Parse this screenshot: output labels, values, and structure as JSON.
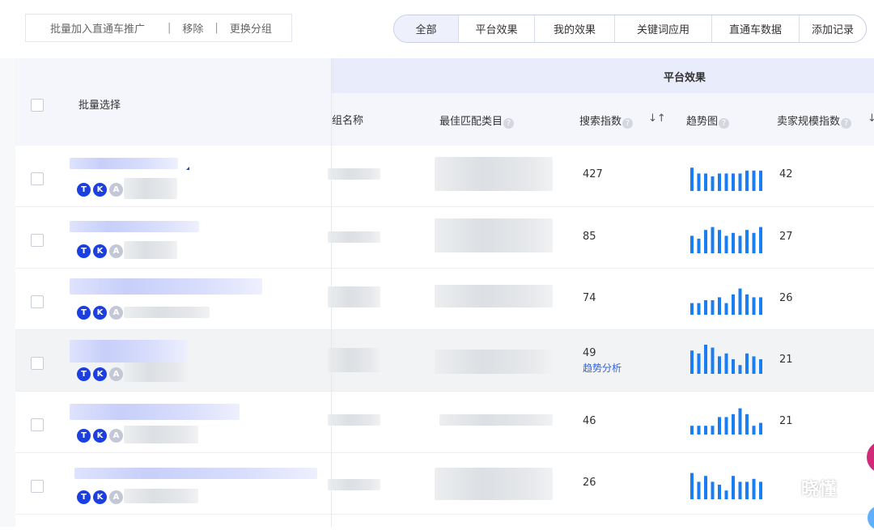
{
  "toolbar": {
    "batch_add_label": "批量加入直通车推广",
    "remove_label": "移除",
    "change_group_label": "更换分组",
    "separator": "|"
  },
  "tabs": [
    {
      "label": "全部",
      "active": true
    },
    {
      "label": "平台效果",
      "active": false
    },
    {
      "label": "我的效果",
      "active": false
    },
    {
      "label": "关键词应用",
      "active": false
    },
    {
      "label": "直通车数据",
      "active": false
    },
    {
      "label": "添加记录",
      "active": false
    }
  ],
  "table": {
    "group_title": "平台效果",
    "headers": {
      "batch_select": "批量选择",
      "group_name": "组名称",
      "best_category": "最佳匹配类目",
      "search_index": "搜索指数",
      "trend": "趋势图",
      "seller_scale": "卖家规模指数",
      "help_glyph": "?",
      "sort_glyph": "↓↑"
    },
    "badges": {
      "t": "T",
      "k": "K",
      "a": "A"
    },
    "rows": [
      {
        "search_index": "427",
        "seller_scale": "42",
        "trend": [
          8,
          6,
          6,
          5,
          6,
          6,
          6,
          6,
          7,
          7,
          7
        ],
        "highlight": false
      },
      {
        "search_index": "85",
        "seller_scale": "27",
        "trend": [
          6,
          5,
          8,
          9,
          8,
          6,
          7,
          6,
          8,
          7,
          9
        ],
        "highlight": false
      },
      {
        "search_index": "74",
        "seller_scale": "26",
        "trend": [
          4,
          4,
          5,
          5,
          6,
          4,
          7,
          9,
          7,
          6,
          6
        ],
        "highlight": false
      },
      {
        "search_index": "49",
        "seller_scale": "21",
        "trend": [
          8,
          7,
          10,
          9,
          6,
          7,
          5,
          3,
          7,
          6,
          5
        ],
        "highlight": true,
        "action_link": "趋势分析"
      },
      {
        "search_index": "46",
        "seller_scale": "21",
        "trend": [
          3,
          3,
          3,
          3,
          6,
          6,
          7,
          9,
          7,
          3,
          4
        ],
        "highlight": false
      },
      {
        "search_index": "26",
        "seller_scale": "",
        "trend": [
          9,
          6,
          8,
          6,
          5,
          3,
          8,
          6,
          6,
          7,
          6
        ],
        "highlight": false
      }
    ]
  },
  "colors": {
    "accent_blue": "#1b3fe0",
    "bar_blue": "#1a7ef2",
    "link_blue": "#2f63e0",
    "header_bg": "#e9ecfa"
  },
  "watermark": {
    "icon": "wechat-icon",
    "text": "晓懂"
  }
}
